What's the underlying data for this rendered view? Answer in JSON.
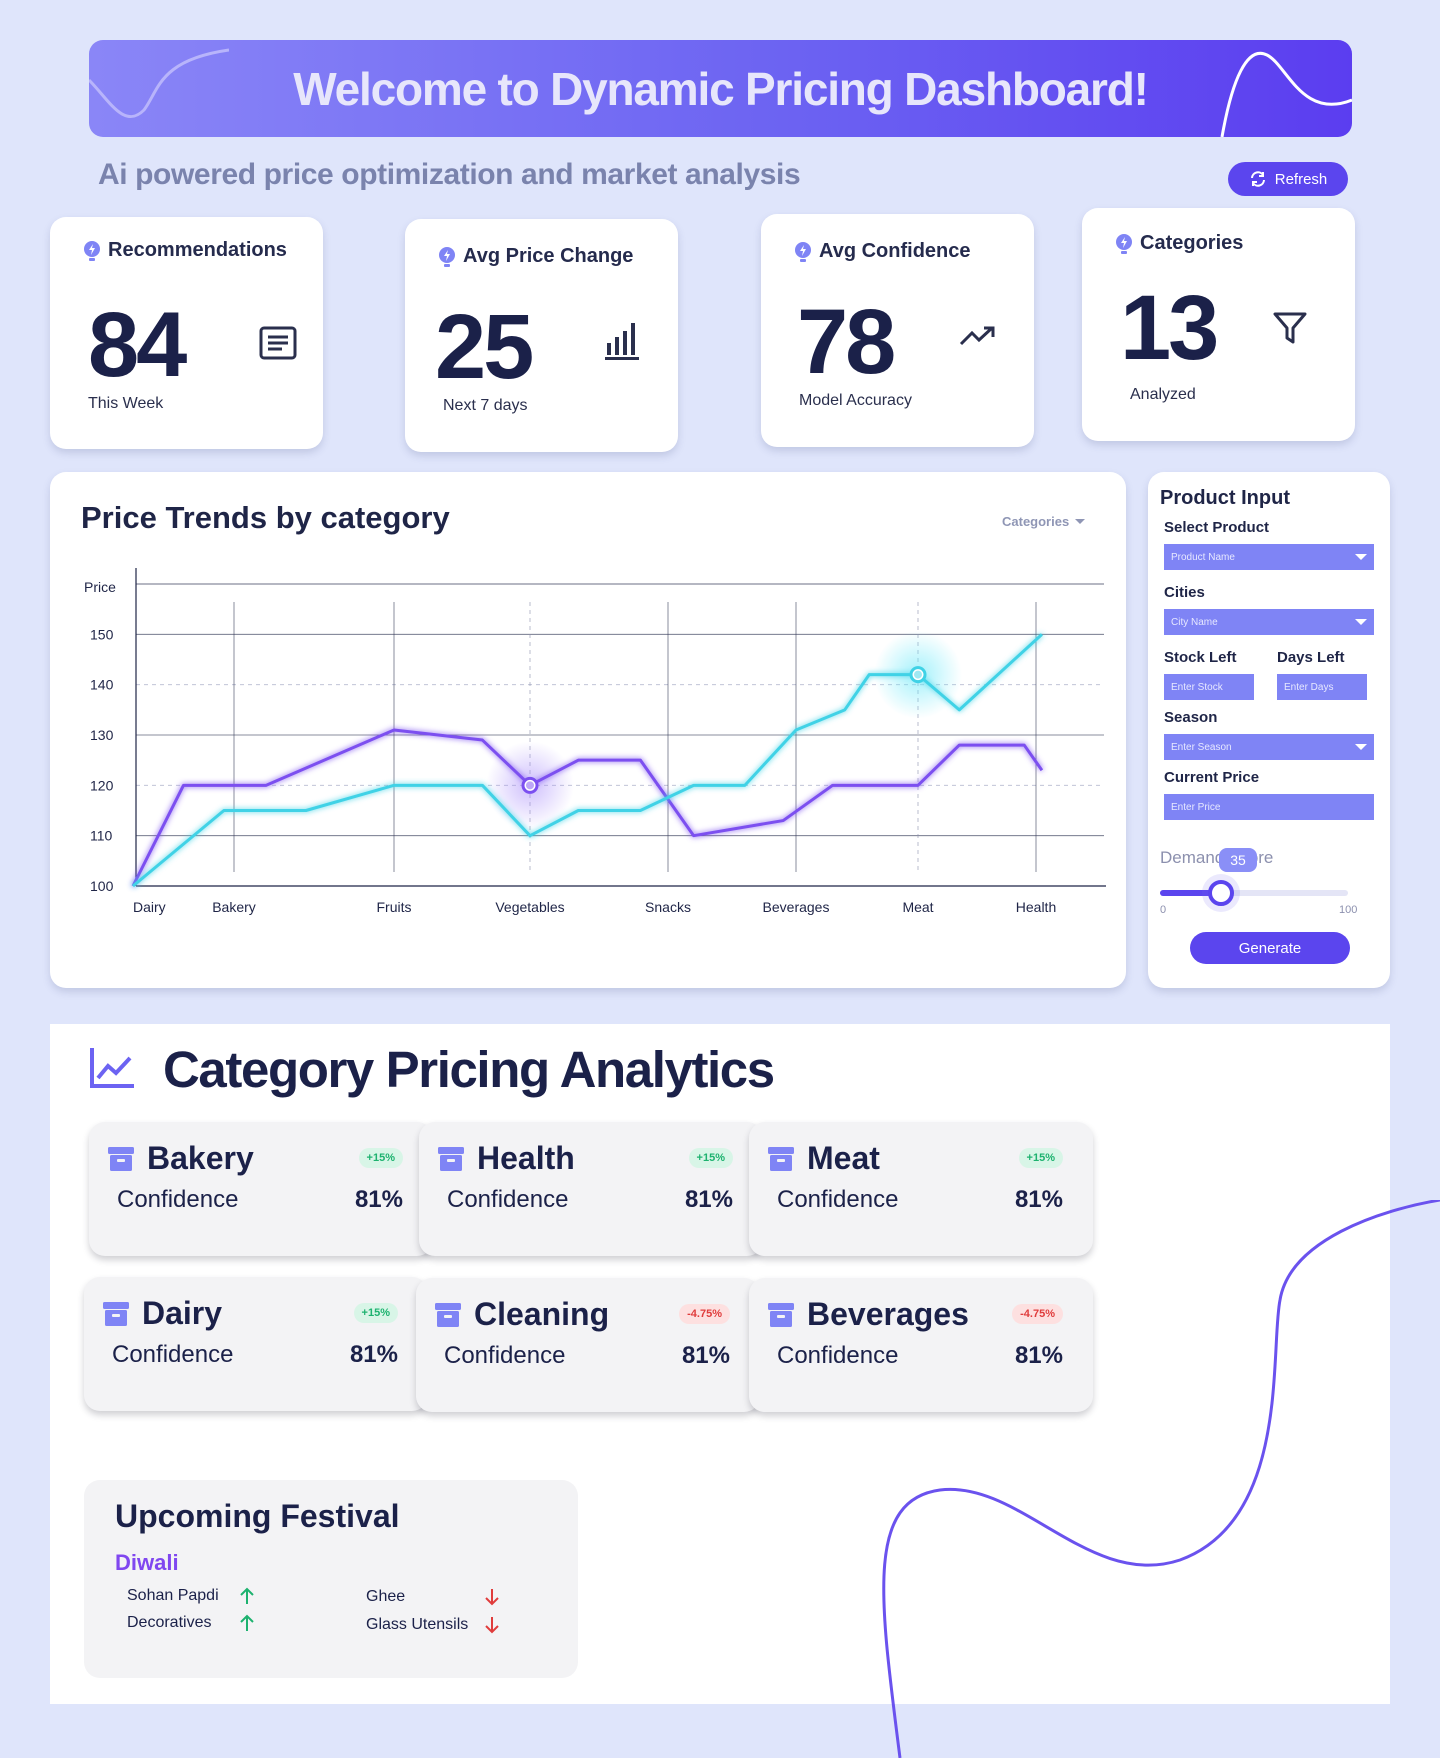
{
  "header": {
    "title": "Welcome to Dynamic Pricing Dashboard!",
    "subtitle": "Ai powered price optimization and market analysis",
    "refresh_label": "Refresh"
  },
  "stats": [
    {
      "title": "Recommendations",
      "value": "84",
      "caption": "This Week",
      "icon": "document-icon"
    },
    {
      "title": "Avg Price Change",
      "value": "25",
      "caption": "Next 7 days",
      "icon": "bar-chart-icon"
    },
    {
      "title": "Avg Confidence",
      "value": "78",
      "caption": "Model Accuracy",
      "icon": "trending-up-icon"
    },
    {
      "title": "Categories",
      "value": "13",
      "caption": "Analyzed",
      "icon": "filter-icon"
    }
  ],
  "chart": {
    "title": "Price Trends by category",
    "dropdown_label": "Categories"
  },
  "chart_data": {
    "type": "line",
    "title": "Price Trends by category",
    "ylabel": "Price",
    "xlabel": "",
    "ylim": [
      100,
      160
    ],
    "y_ticks": [
      100,
      110,
      120,
      130,
      140,
      150
    ],
    "grid": true,
    "categories": [
      "Dairy",
      "Bakery",
      "Fruits",
      "Vegetables",
      "Snacks",
      "Beverages",
      "Meat",
      "Health"
    ],
    "series": [
      {
        "color": "#7b4ff0",
        "x": [
          0,
          0.5,
          1.2,
          2.0,
          2.65,
          3.0,
          3.35,
          3.8,
          4.2,
          4.9,
          5.3,
          6.0,
          6.35,
          6.9,
          7.05
        ],
        "values": [
          100,
          120,
          120,
          131,
          129,
          120,
          125,
          125,
          110,
          113,
          120,
          120,
          128,
          128,
          123
        ]
      },
      {
        "color": "#3fd2e6",
        "x": [
          0,
          0.9,
          1.45,
          2.0,
          2.65,
          3.0,
          3.35,
          3.8,
          4.2,
          4.6,
          5.0,
          5.4,
          5.6,
          6.0,
          6.35,
          7.05
        ],
        "values": [
          100,
          115,
          115,
          120,
          120,
          110,
          115,
          115,
          120,
          120,
          131,
          135,
          142,
          142,
          135,
          150
        ]
      }
    ],
    "highlights": [
      {
        "series": 0,
        "category": "Vegetables",
        "value": 120
      },
      {
        "series": 1,
        "category": "Meat",
        "value": 142
      }
    ]
  },
  "product_input": {
    "title": "Product Input",
    "select_product_label": "Select Product",
    "select_product_placeholder": "Product Name",
    "cities_label": "Cities",
    "cities_placeholder": "City Name",
    "stock_label": "Stock Left",
    "stock_placeholder": "Enter Stock",
    "days_label": "Days Left",
    "days_placeholder": "Enter Days",
    "season_label": "Season",
    "season_placeholder": "Enter Season",
    "price_label": "Current Price",
    "price_placeholder": "Enter Price",
    "slider_label": "Demand Score",
    "slider_value": 35,
    "slider_min": "0",
    "slider_max": "100",
    "generate_label": "Generate"
  },
  "analytics": {
    "title": "Category Pricing Analytics",
    "cards": [
      {
        "name": "Bakery",
        "change": "+15%",
        "trend": "up",
        "label": "Confidence",
        "value": "81%"
      },
      {
        "name": "Health",
        "change": "+15%",
        "trend": "up",
        "label": "Confidence",
        "value": "81%"
      },
      {
        "name": "Meat",
        "change": "+15%",
        "trend": "up",
        "label": "Confidence",
        "value": "81%"
      },
      {
        "name": "Dairy",
        "change": "+15%",
        "trend": "up",
        "label": "Confidence",
        "value": "81%"
      },
      {
        "name": "Cleaning",
        "change": "-4.75%",
        "trend": "down",
        "label": "Confidence",
        "value": "81%"
      },
      {
        "name": "Beverages",
        "change": "-4.75%",
        "trend": "down",
        "label": "Confidence",
        "value": "81%"
      }
    ]
  },
  "festival": {
    "title": "Upcoming Festival",
    "name": "Diwali",
    "items": [
      {
        "name": "Sohan Papdi",
        "trend": "up"
      },
      {
        "name": "Decoratives",
        "trend": "up"
      },
      {
        "name": "Ghee",
        "trend": "down"
      },
      {
        "name": "Glass Utensils",
        "trend": "down"
      }
    ]
  },
  "colors": {
    "accent": "#5b45ee",
    "background": "#dfe5fb",
    "up": "#1db26f",
    "down": "#e03c3c"
  }
}
